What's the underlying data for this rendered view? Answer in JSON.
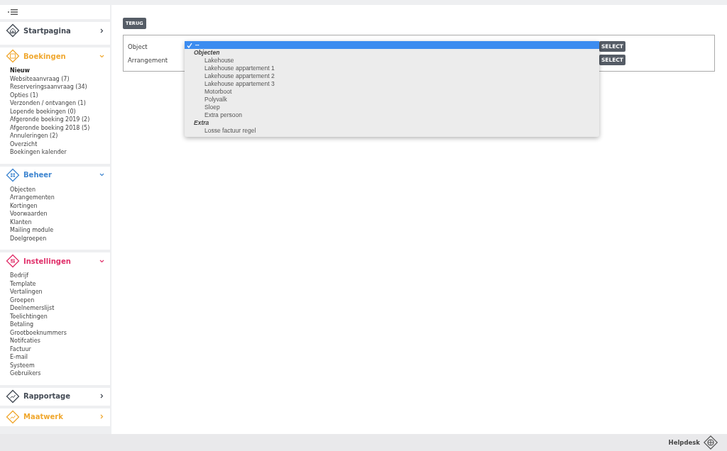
{
  "sidebar": {
    "sections": [
      {
        "title": "Startpagina",
        "color": "#444b55",
        "expanded": false
      },
      {
        "title": "Boekingen",
        "color": "#f0a830",
        "expanded": true,
        "items": [
          {
            "label": "Nieuw",
            "selected": true
          },
          {
            "label": "Websiteaanvraag (7)",
            "selected": false
          },
          {
            "label": "Reserveringsaanvraag (34)",
            "selected": false
          },
          {
            "label": "Opties (1)",
            "selected": false
          },
          {
            "label": "Verzonden / ontvangen (1)",
            "selected": false
          },
          {
            "label": "Lopende boekingen (0)",
            "selected": false
          },
          {
            "label": "Afgeronde boeking 2019 (2)",
            "selected": false
          },
          {
            "label": "Afgeronde boeking 2018 (5)",
            "selected": false
          },
          {
            "label": "Annuleringen (2)",
            "selected": false
          },
          {
            "label": "Overzicht",
            "selected": false
          },
          {
            "label": "Boekingen kalender",
            "selected": false
          }
        ]
      },
      {
        "title": "Beheer",
        "color": "#3f86d0",
        "expanded": true,
        "items": [
          {
            "label": "Objecten",
            "selected": false
          },
          {
            "label": "Arrangementen",
            "selected": false
          },
          {
            "label": "Kortingen",
            "selected": false
          },
          {
            "label": "Voorwaarden",
            "selected": false
          },
          {
            "label": "Klanten",
            "selected": false
          },
          {
            "label": "Mailing module",
            "selected": false
          },
          {
            "label": "Doelgroepen",
            "selected": false
          }
        ]
      },
      {
        "title": "Instellingen",
        "color": "#e0306a",
        "expanded": true,
        "items": [
          {
            "label": "Bedrijf",
            "selected": false
          },
          {
            "label": "Template",
            "selected": false
          },
          {
            "label": "Vertalingen",
            "selected": false
          },
          {
            "label": "Groepen",
            "selected": false
          },
          {
            "label": "Deelnemerslijst",
            "selected": false
          },
          {
            "label": "Toelichtingen",
            "selected": false
          },
          {
            "label": "Betaling",
            "selected": false
          },
          {
            "label": "Grootboeknummers",
            "selected": false
          },
          {
            "label": "Notifcaties",
            "selected": false
          },
          {
            "label": "Factuur",
            "selected": false
          },
          {
            "label": "E-mail",
            "selected": false
          },
          {
            "label": "Systeem",
            "selected": false
          },
          {
            "label": "Gebruikers",
            "selected": false
          }
        ]
      },
      {
        "title": "Rapportage",
        "color": "#444b55",
        "expanded": false
      },
      {
        "title": "Maatwerk",
        "color": "#f0a830",
        "expanded": false
      }
    ]
  },
  "back_button": "TERUG",
  "form": {
    "fields": [
      {
        "label": "Object",
        "button": "SELECT"
      },
      {
        "label": "Arrangement",
        "button": "SELECT"
      }
    ]
  },
  "dropdown": {
    "options": [
      {
        "kind": "option",
        "label": "--",
        "selected": true
      },
      {
        "kind": "group",
        "label": "Objecten",
        "children": [
          {
            "label": "Lakehouse",
            "selected": false
          },
          {
            "label": "Lakehouse appartement 1",
            "selected": false
          },
          {
            "label": "Lakehouse appartement 2",
            "selected": false
          },
          {
            "label": "Lakehouse appartement 3",
            "selected": false
          },
          {
            "label": "Motorboot",
            "selected": false
          },
          {
            "label": "Polyvalk",
            "selected": false
          },
          {
            "label": "Sloep",
            "selected": false
          },
          {
            "label": "Extra persoon",
            "selected": false
          }
        ]
      },
      {
        "kind": "group",
        "label": "Extra",
        "children": [
          {
            "label": "Losse factuur regel",
            "selected": false
          }
        ]
      }
    ]
  },
  "footer": {
    "helpdesk": "Helpdesk"
  }
}
